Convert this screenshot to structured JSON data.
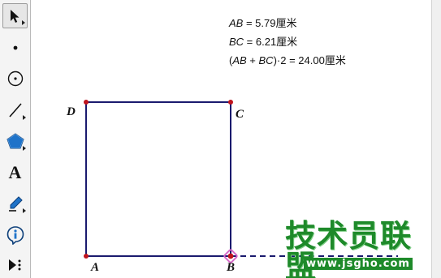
{
  "toolbox": {
    "tools": [
      {
        "name": "selection-arrow-tool",
        "icon": "arrow-icon",
        "selected": true,
        "has_submenu": true
      },
      {
        "name": "point-tool",
        "icon": "point-icon",
        "selected": false,
        "has_submenu": false
      },
      {
        "name": "compass-tool",
        "icon": "compass-icon",
        "selected": false,
        "has_submenu": false
      },
      {
        "name": "straightedge-tool",
        "icon": "line-icon",
        "selected": false,
        "has_submenu": true
      },
      {
        "name": "polygon-tool",
        "icon": "pentagon-icon",
        "selected": false,
        "has_submenu": true
      },
      {
        "name": "text-tool",
        "icon": "text-icon",
        "label": "A",
        "selected": false,
        "has_submenu": false
      },
      {
        "name": "marker-tool",
        "icon": "pencil-icon",
        "selected": false,
        "has_submenu": true
      },
      {
        "name": "information-tool",
        "icon": "info-icon",
        "selected": false,
        "has_submenu": false
      },
      {
        "name": "custom-tools",
        "icon": "custom-tool-icon",
        "selected": false,
        "has_submenu": false
      }
    ]
  },
  "measurements": {
    "ab": {
      "name": "AB",
      "value": " = 5.79厘米"
    },
    "bc": {
      "name": "BC",
      "value": " = 6.21厘米"
    },
    "calc": {
      "open": "(",
      "ab": "AB",
      "plus": " + ",
      "bc": "BC",
      "close": ")·2 = 24.00厘米"
    }
  },
  "points": {
    "a": "A",
    "b": "B",
    "c": "C",
    "d": "D"
  },
  "colors": {
    "segment": "#1a1a6e",
    "point": "#c0141e",
    "selected_point_halo": "#d768c8",
    "watermark": "#1e8a2a"
  },
  "watermark": {
    "title": "技术员联盟",
    "url": "www.jsgho.com"
  }
}
